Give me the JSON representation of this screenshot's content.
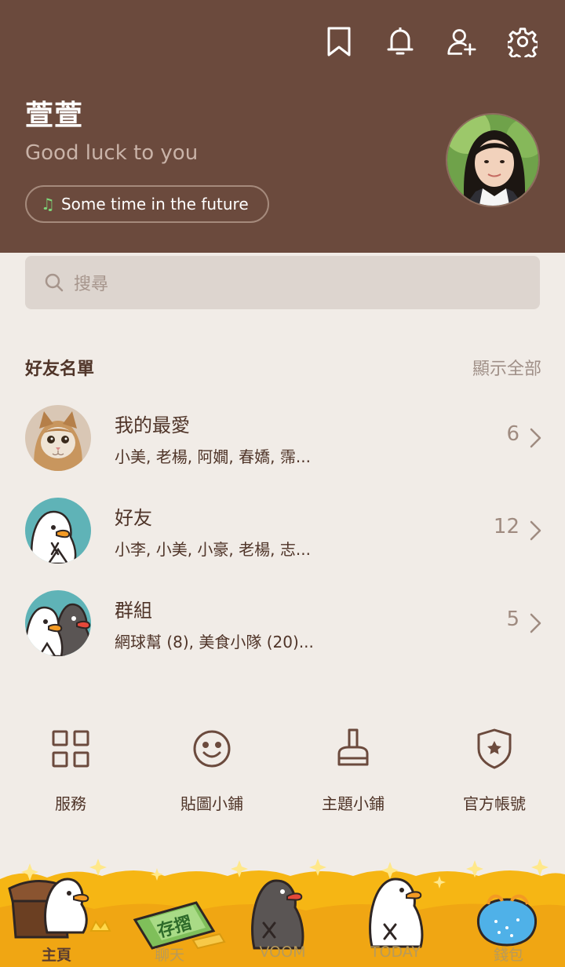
{
  "profile": {
    "name": "萱萱",
    "status": "Good luck to you",
    "music": "Some time in the future"
  },
  "search": {
    "placeholder": "搜尋"
  },
  "friends_section": {
    "title": "好友名單",
    "more": "顯示全部",
    "rows": [
      {
        "name": "我的最愛",
        "members": "小美, 老楊, 阿嫺, 春嬌, 霈...",
        "count": "6"
      },
      {
        "name": "好友",
        "members": "小李, 小美, 小豪, 老楊, 志...",
        "count": "12"
      },
      {
        "name": "群組",
        "members": "網球幫 (8), 美食小隊 (20)...",
        "count": "5"
      }
    ]
  },
  "services": [
    {
      "label": "服務",
      "icon": "grid-icon"
    },
    {
      "label": "貼圖小鋪",
      "icon": "smiley-icon"
    },
    {
      "label": "主題小鋪",
      "icon": "brush-icon"
    },
    {
      "label": "官方帳號",
      "icon": "shield-star-icon"
    }
  ],
  "tabs": [
    {
      "label": "主頁",
      "active": true
    },
    {
      "label": "聊天",
      "active": false
    },
    {
      "label": "VOOM",
      "active": false
    },
    {
      "label": "TODAY",
      "active": false
    },
    {
      "label": "錢包",
      "active": false
    }
  ],
  "colors": {
    "header": "#6b4a3d",
    "background": "#f1ece7",
    "text": "#4f3428",
    "tabbar": "#f6b614"
  }
}
